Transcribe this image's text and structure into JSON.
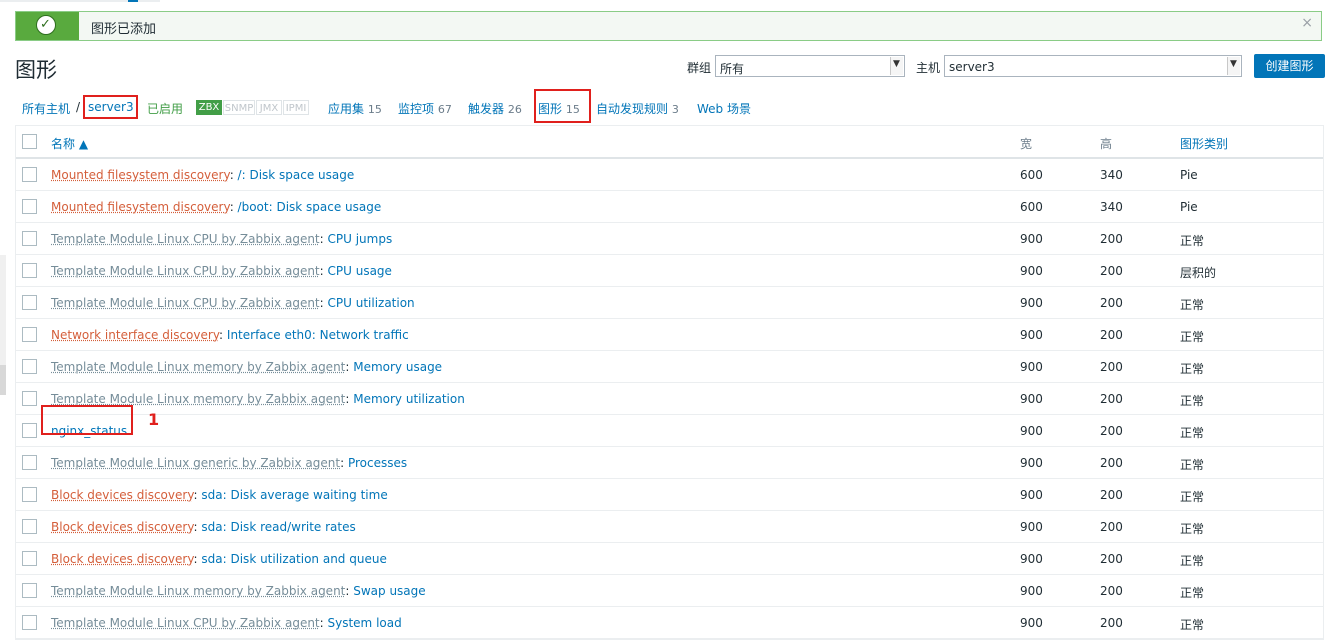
{
  "message": {
    "text": "图形已添加",
    "close": "×"
  },
  "page_title": "图形",
  "filter": {
    "group_label": "群组",
    "group_value": "所有",
    "host_label": "主机",
    "host_value": "server3",
    "create_button": "创建图形"
  },
  "nav": {
    "all_hosts": "所有主机",
    "separator": "/",
    "host": "server3",
    "enabled": "已启用",
    "badges": [
      "ZBX",
      "SNMP",
      "JMX",
      "IPMI"
    ],
    "apps_label": "应用集",
    "apps_count": "15",
    "items_label": "监控项",
    "items_count": "67",
    "triggers_label": "触发器",
    "triggers_count": "26",
    "graphs_label": "图形",
    "graphs_count": "15",
    "discovery_label": "自动发现规则",
    "discovery_count": "3",
    "web_label": "Web 场景"
  },
  "table": {
    "headers": {
      "name": "名称 ▲",
      "width": "宽",
      "height": "高",
      "type": "图形类别"
    },
    "rows": [
      {
        "prefix": "Mounted filesystem discovery",
        "prefix_style": "red",
        "name": "/: Disk space usage",
        "width": "600",
        "height": "340",
        "type": "Pie"
      },
      {
        "prefix": "Mounted filesystem discovery",
        "prefix_style": "red",
        "name": "/boot: Disk space usage",
        "width": "600",
        "height": "340",
        "type": "Pie"
      },
      {
        "prefix": "Template Module Linux CPU by Zabbix agent",
        "prefix_style": "gray",
        "name": "CPU jumps",
        "width": "900",
        "height": "200",
        "type": "正常"
      },
      {
        "prefix": "Template Module Linux CPU by Zabbix agent",
        "prefix_style": "gray",
        "name": "CPU usage",
        "width": "900",
        "height": "200",
        "type": "层积的"
      },
      {
        "prefix": "Template Module Linux CPU by Zabbix agent",
        "prefix_style": "gray",
        "name": "CPU utilization",
        "width": "900",
        "height": "200",
        "type": "正常"
      },
      {
        "prefix": "Network interface discovery",
        "prefix_style": "red",
        "name": "Interface eth0: Network traffic",
        "width": "900",
        "height": "200",
        "type": "正常"
      },
      {
        "prefix": "Template Module Linux memory by Zabbix agent",
        "prefix_style": "gray",
        "name": "Memory usage",
        "width": "900",
        "height": "200",
        "type": "正常"
      },
      {
        "prefix": "Template Module Linux memory by Zabbix agent",
        "prefix_style": "gray",
        "name": "Memory utilization",
        "width": "900",
        "height": "200",
        "type": "正常"
      },
      {
        "prefix": "",
        "prefix_style": "none",
        "name": "nginx_status",
        "width": "900",
        "height": "200",
        "type": "正常"
      },
      {
        "prefix": "Template Module Linux generic by Zabbix agent",
        "prefix_style": "gray",
        "name": "Processes",
        "width": "900",
        "height": "200",
        "type": "正常"
      },
      {
        "prefix": "Block devices discovery",
        "prefix_style": "red",
        "name": "sda: Disk average waiting time",
        "width": "900",
        "height": "200",
        "type": "正常"
      },
      {
        "prefix": "Block devices discovery",
        "prefix_style": "red",
        "name": "sda: Disk read/write rates",
        "width": "900",
        "height": "200",
        "type": "正常"
      },
      {
        "prefix": "Block devices discovery",
        "prefix_style": "red",
        "name": "sda: Disk utilization and queue",
        "width": "900",
        "height": "200",
        "type": "正常"
      },
      {
        "prefix": "Template Module Linux memory by Zabbix agent",
        "prefix_style": "gray",
        "name": "Swap usage",
        "width": "900",
        "height": "200",
        "type": "正常"
      },
      {
        "prefix": "Template Module Linux CPU by Zabbix agent",
        "prefix_style": "gray",
        "name": "System load",
        "width": "900",
        "height": "200",
        "type": "正常"
      }
    ]
  },
  "annotation": "1",
  "colors": {
    "link": "#0275b8",
    "discovery_prefix": "#d45e3a",
    "template_prefix": "#768d99",
    "success": "#59aa3e",
    "highlight": "#e0201d"
  }
}
